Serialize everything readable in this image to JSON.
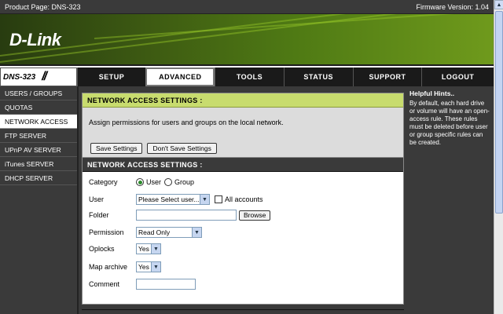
{
  "topbar": {
    "product": "Product Page: DNS-323",
    "firmware": "Firmware Version: 1.04"
  },
  "brand": {
    "logo": "D-Link"
  },
  "model": "DNS-323",
  "tabs": [
    {
      "label": "SETUP"
    },
    {
      "label": "ADVANCED"
    },
    {
      "label": "TOOLS"
    },
    {
      "label": "STATUS"
    },
    {
      "label": "SUPPORT"
    },
    {
      "label": "LOGOUT"
    }
  ],
  "sidebar": {
    "items": [
      {
        "label": "USERS / GROUPS"
      },
      {
        "label": "QUOTAS"
      },
      {
        "label": "NETWORK ACCESS"
      },
      {
        "label": "FTP SERVER"
      },
      {
        "label": "UPnP AV SERVER"
      },
      {
        "label": "iTunes SERVER"
      },
      {
        "label": "DHCP SERVER"
      }
    ]
  },
  "panel1": {
    "title": "NETWORK ACCESS SETTINGS :",
    "description": "Assign permissions for users and groups on the local network.",
    "save_label": "Save Settings",
    "dont_save_label": "Don't Save Settings"
  },
  "panel2": {
    "title": "NETWORK ACCESS SETTINGS :",
    "category_label": "Category",
    "category_user": "User",
    "category_group": "Group",
    "user_label": "User",
    "user_select": "Please Select user...",
    "all_accounts": "All accounts",
    "folder_label": "Folder",
    "browse_label": "Browse",
    "permission_label": "Permission",
    "permission_value": "Read Only",
    "oplocks_label": "Oplocks",
    "oplocks_value": "Yes",
    "map_archive_label": "Map archive",
    "map_archive_value": "Yes",
    "comment_label": "Comment"
  },
  "hints": {
    "title": "Helpful Hints..",
    "text": "By default, each hard drive or volume will have an open-access rule. These rules must be deleted before user or group specific rules can be created."
  }
}
